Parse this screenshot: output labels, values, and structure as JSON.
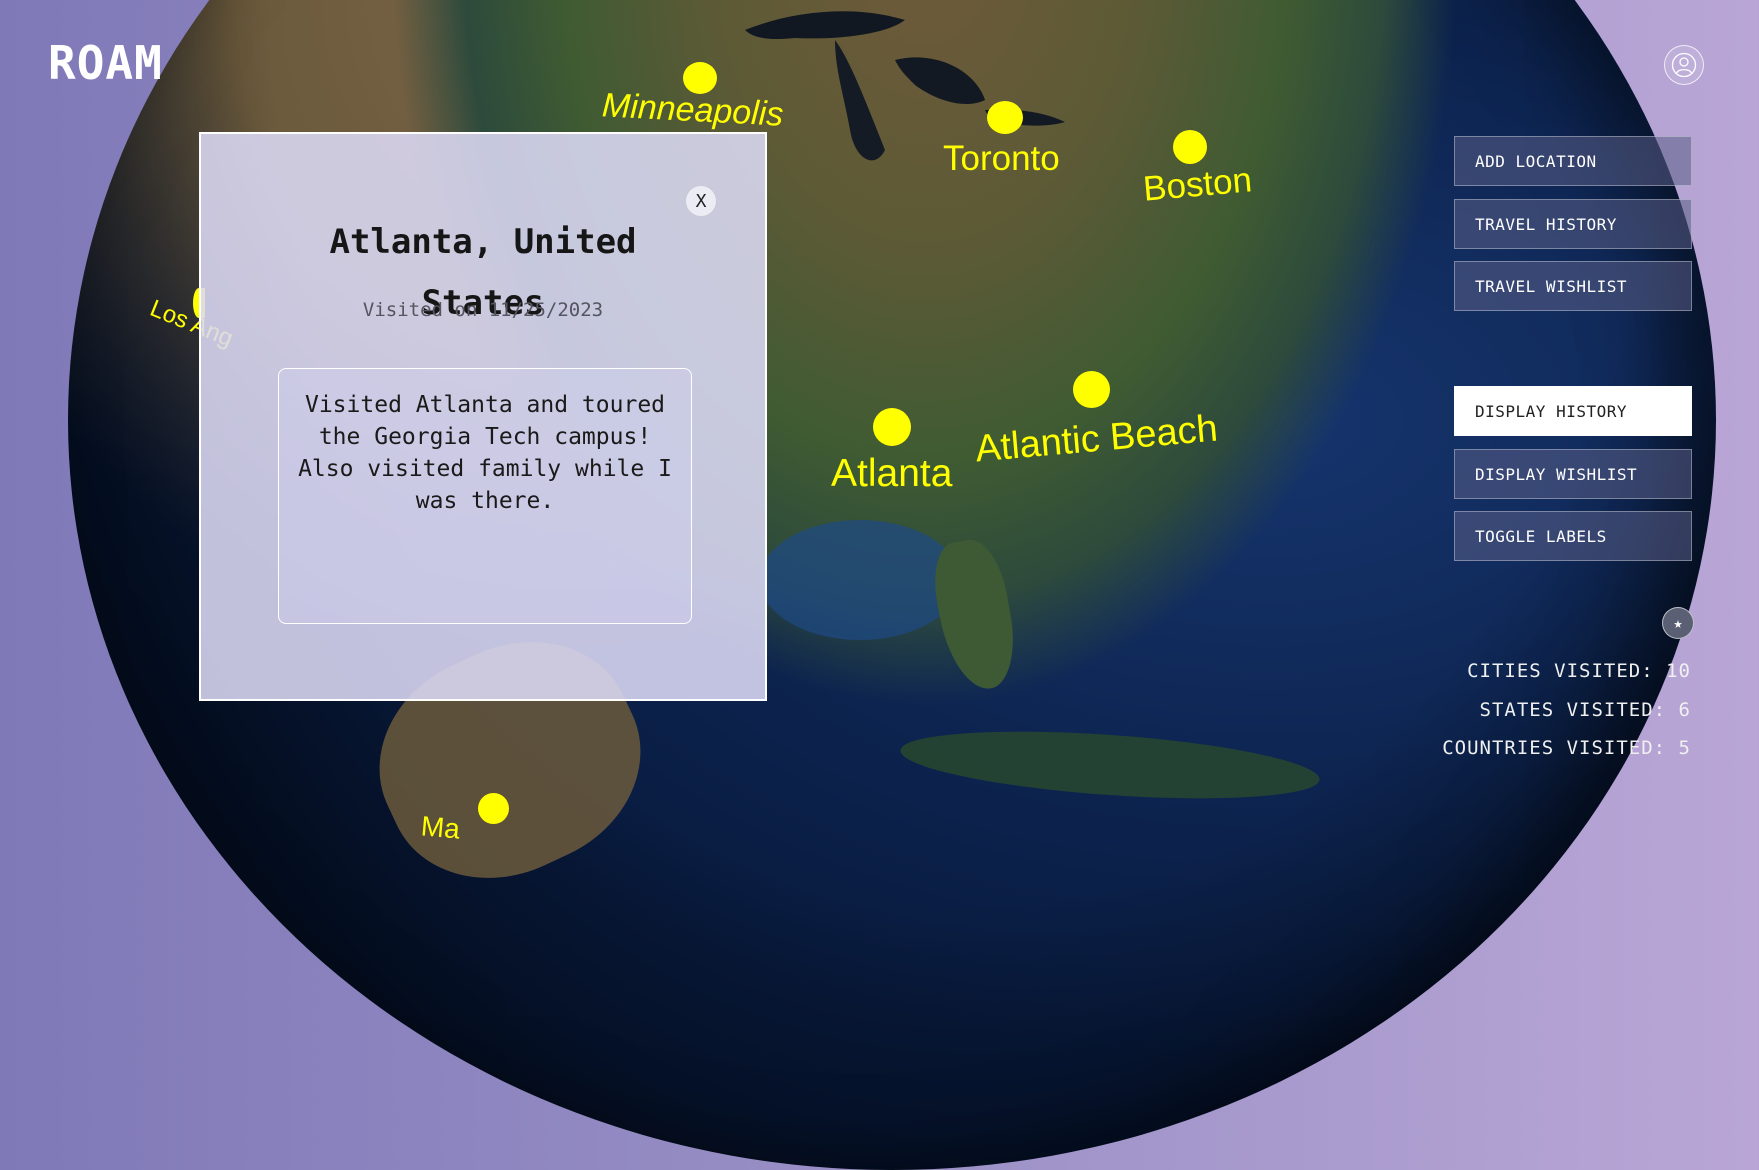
{
  "app": {
    "logo": "ROAM"
  },
  "header": {
    "profile_icon": "user-circle-icon"
  },
  "map": {
    "cities": [
      {
        "name": "Minneapolis"
      },
      {
        "name": "Toronto"
      },
      {
        "name": "Boston"
      },
      {
        "name": "Atlantic Beach"
      },
      {
        "name": "Atlanta"
      },
      {
        "name": "Los Angeles",
        "visible_text": "Los Ang"
      },
      {
        "name": "Mexico City",
        "visible_text": "Ma"
      }
    ],
    "marker_color": "#ffff00"
  },
  "menu": {
    "add_location": "ADD LOCATION",
    "travel_history": "TRAVEL HISTORY",
    "travel_wishlist": "TRAVEL WISHLIST",
    "display_history": "DISPLAY HISTORY",
    "display_wishlist": "DISPLAY WISHLIST",
    "toggle_labels": "TOGGLE LABELS",
    "active": "display_history"
  },
  "stats": {
    "cities": "CITIES VISITED: 10",
    "states": "STATES VISITED: 6",
    "countries": "COUNTRIES VISITED: 5",
    "star_icon": "star-icon"
  },
  "popup": {
    "title_line1": "Atlanta, United",
    "title_line2": "States",
    "date": "Visited on 11/25/2023",
    "notes": "Visited Atlanta and toured the Georgia Tech campus! Also visited family while I was there.",
    "close_label": "X"
  }
}
